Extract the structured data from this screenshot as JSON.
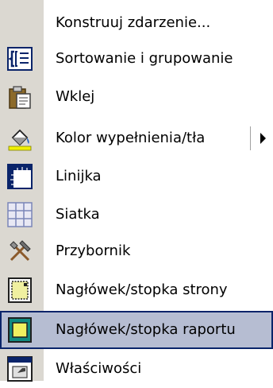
{
  "menu": {
    "items": [
      {
        "label": "Konstruuj zdarzenie...",
        "icon": "none",
        "highlighted": false,
        "submenu": false
      },
      {
        "label": "Sortowanie i grupowanie",
        "icon": "sorting-grouping-icon",
        "highlighted": false,
        "submenu": false
      },
      {
        "label": "Wklej",
        "icon": "paste-icon",
        "highlighted": false,
        "submenu": false
      },
      {
        "label": "Kolor wypełnienia/tła",
        "icon": "fill-color-icon",
        "highlighted": false,
        "submenu": true
      },
      {
        "label": "Linijka",
        "icon": "ruler-icon",
        "highlighted": false,
        "submenu": false
      },
      {
        "label": "Siatka",
        "icon": "grid-icon",
        "highlighted": false,
        "submenu": false
      },
      {
        "label": "Przybornik",
        "icon": "toolbox-icon",
        "highlighted": false,
        "submenu": false
      },
      {
        "label": "Nagłówek/stopka strony",
        "icon": "page-header-footer-icon",
        "highlighted": false,
        "submenu": false
      },
      {
        "label": "Nagłówek/stopka raportu",
        "icon": "report-header-footer-icon",
        "highlighted": true,
        "submenu": false
      },
      {
        "label": "Właściwości",
        "icon": "properties-icon",
        "highlighted": false,
        "submenu": false
      }
    ]
  },
  "colors": {
    "gutter": "#dbd8d1",
    "highlight_bg": "#b6bdd2",
    "highlight_border": "#0a246a",
    "icon_blue": "#0a246a"
  }
}
